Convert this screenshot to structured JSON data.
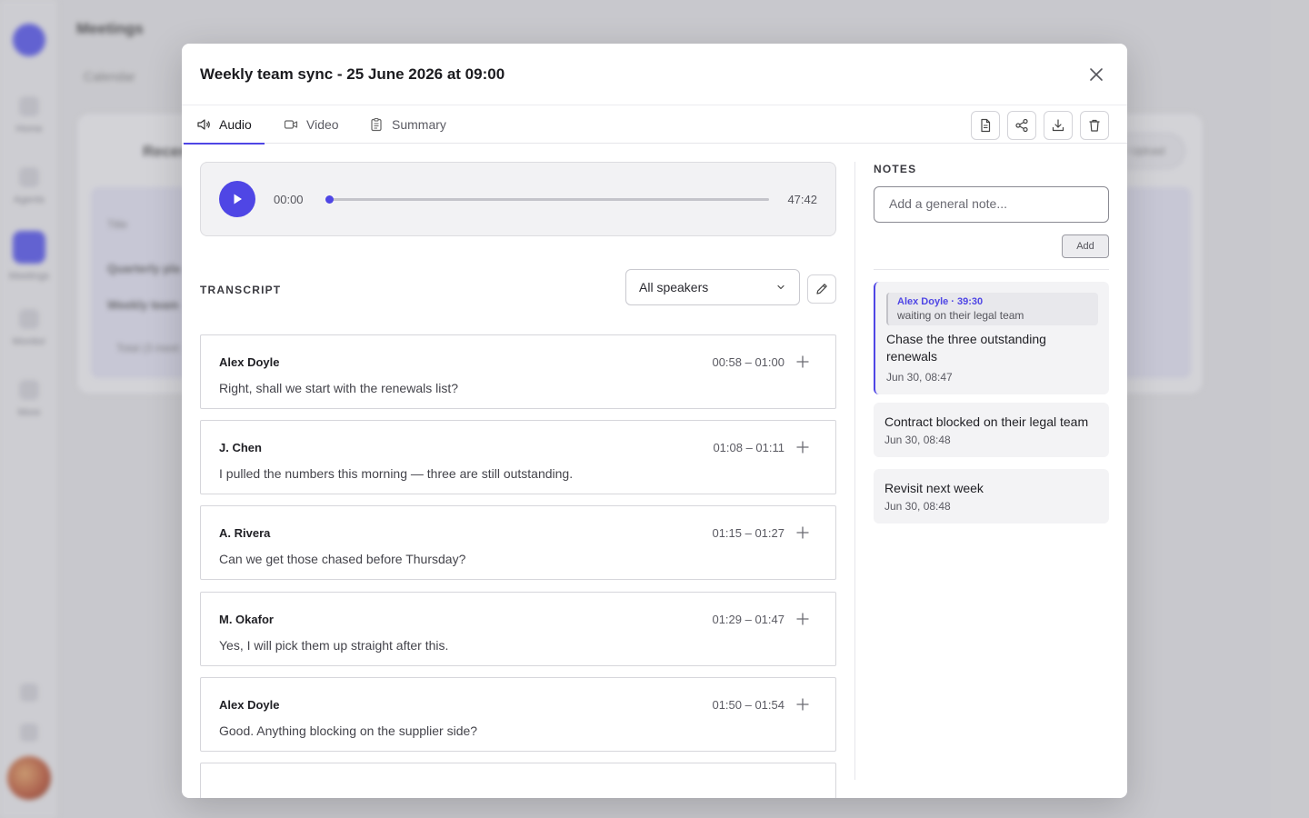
{
  "background": {
    "page_title": "Meetings",
    "tab_label": "Calendar",
    "nav": [
      "Home",
      "Agents",
      "Meetings",
      "Monitor",
      "More"
    ],
    "card_title": "Recent",
    "rows": [
      "Title",
      "Quarterly pla",
      "Weekly team",
      "Total (3 meet"
    ],
    "pill_label": "+ Upload"
  },
  "modal": {
    "title": "Weekly team sync - 25 June 2026 at 09:00",
    "tabs": [
      {
        "label": "Audio",
        "icon": "speaker-icon"
      },
      {
        "label": "Video",
        "icon": "video-icon"
      },
      {
        "label": "Summary",
        "icon": "clipboard-icon"
      }
    ],
    "toolbar": [
      "document-icon",
      "share-icon",
      "download-icon",
      "trash-icon"
    ]
  },
  "player": {
    "current_time": "00:00",
    "total_time": "47:42",
    "progress_percent": 0
  },
  "transcript": {
    "label": "TRANSCRIPT",
    "speaker_filter": "All speakers",
    "segments": [
      {
        "speaker": "Alex Doyle",
        "time": "00:58 – 01:00",
        "text": "Right, shall we start with the renewals list?"
      },
      {
        "speaker": "J. Chen",
        "time": "01:08 – 01:11",
        "text": "I pulled the numbers this morning — three are still outstanding."
      },
      {
        "speaker": "A. Rivera",
        "time": "01:15 – 01:27",
        "text": "Can we get those chased before Thursday?"
      },
      {
        "speaker": "M. Okafor",
        "time": "01:29 – 01:47",
        "text": "Yes, I will pick them up straight after this."
      },
      {
        "speaker": "Alex Doyle",
        "time": "01:50 – 01:54",
        "text": "Good. Anything blocking on the supplier side?"
      }
    ]
  },
  "notes": {
    "label": "NOTES",
    "placeholder": "Add a general note...",
    "add_label": "Add",
    "items": [
      {
        "quote_ref": "Alex Doyle · 39:30",
        "quote_text": "waiting on their legal team",
        "body": "Chase the three outstanding renewals",
        "date": "Jun 30, 08:47"
      },
      {
        "body": "Contract blocked on their legal team",
        "date": "Jun 30, 08:48"
      },
      {
        "body": "Revisit next week",
        "date": "Jun 30, 08:48"
      }
    ]
  },
  "colors": {
    "accent": "#4f46e5",
    "overlay": "#78787f"
  }
}
